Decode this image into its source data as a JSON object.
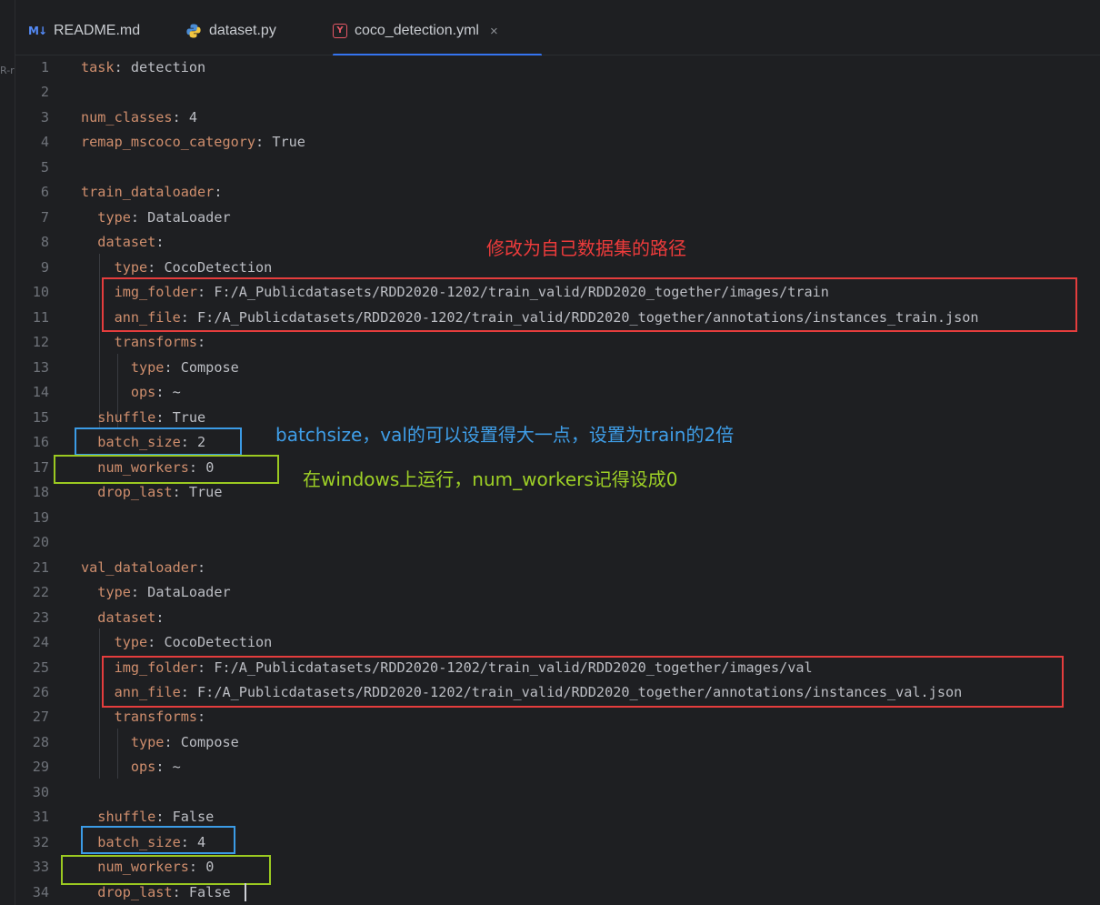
{
  "left_fragment": "R-r",
  "tabs": [
    {
      "icon": "markdown-icon",
      "icon_text": "M↓",
      "label": "README.md"
    },
    {
      "icon": "python-icon",
      "label": "dataset.py"
    },
    {
      "icon": "yaml-icon",
      "icon_text": "Y",
      "label": "coco_detection.yml",
      "active": true,
      "close": "×"
    }
  ],
  "lines": [
    {
      "n": "1",
      "key": "task",
      "val": " detection"
    },
    {
      "n": "2"
    },
    {
      "n": "3",
      "key": "num_classes",
      "val": " 4"
    },
    {
      "n": "4",
      "key": "remap_mscoco_category",
      "val": " True"
    },
    {
      "n": "5"
    },
    {
      "n": "6",
      "key": "train_dataloader",
      "val": ""
    },
    {
      "n": "7",
      "indent": "  ",
      "key": "type",
      "val": " DataLoader"
    },
    {
      "n": "8",
      "indent": "  ",
      "key": "dataset",
      "val": ""
    },
    {
      "n": "9",
      "indent": "    ",
      "key": "type",
      "val": " CocoDetection"
    },
    {
      "n": "10",
      "indent": "    ",
      "key": "img_folder",
      "val": " F:/A_Publicdatasets/RDD2020-1202/train_valid/RDD2020_together/images/train"
    },
    {
      "n": "11",
      "indent": "    ",
      "key": "ann_file",
      "val": " F:/A_Publicdatasets/RDD2020-1202/train_valid/RDD2020_together/annotations/instances_train.json"
    },
    {
      "n": "12",
      "indent": "    ",
      "key": "transforms",
      "val": ""
    },
    {
      "n": "13",
      "indent": "      ",
      "key": "type",
      "val": " Compose"
    },
    {
      "n": "14",
      "indent": "      ",
      "key": "ops",
      "val": " ~"
    },
    {
      "n": "15",
      "indent": "  ",
      "key": "shuffle",
      "val": " True"
    },
    {
      "n": "16",
      "indent": "  ",
      "key": "batch_size",
      "val": " 2"
    },
    {
      "n": "17",
      "indent": "  ",
      "key": "num_workers",
      "val": " 0"
    },
    {
      "n": "18",
      "indent": "  ",
      "key": "drop_last",
      "val": " True"
    },
    {
      "n": "19"
    },
    {
      "n": "20"
    },
    {
      "n": "21",
      "key": "val_dataloader",
      "val": ""
    },
    {
      "n": "22",
      "indent": "  ",
      "key": "type",
      "val": " DataLoader"
    },
    {
      "n": "23",
      "indent": "  ",
      "key": "dataset",
      "val": ""
    },
    {
      "n": "24",
      "indent": "    ",
      "key": "type",
      "val": " CocoDetection"
    },
    {
      "n": "25",
      "indent": "    ",
      "key": "img_folder",
      "val": " F:/A_Publicdatasets/RDD2020-1202/train_valid/RDD2020_together/images/val"
    },
    {
      "n": "26",
      "indent": "    ",
      "key": "ann_file",
      "val": " F:/A_Publicdatasets/RDD2020-1202/train_valid/RDD2020_together/annotations/instances_val.json"
    },
    {
      "n": "27",
      "indent": "    ",
      "key": "transforms",
      "val": ""
    },
    {
      "n": "28",
      "indent": "      ",
      "key": "type",
      "val": " Compose"
    },
    {
      "n": "29",
      "indent": "      ",
      "key": "ops",
      "val": " ~"
    },
    {
      "n": "30"
    },
    {
      "n": "31",
      "indent": "  ",
      "key": "shuffle",
      "val": " False"
    },
    {
      "n": "32",
      "indent": "  ",
      "key": "batch_size",
      "val": " 4"
    },
    {
      "n": "33",
      "indent": "  ",
      "key": "num_workers",
      "val": " 0"
    },
    {
      "n": "34",
      "indent": "  ",
      "key": "drop_last",
      "val": " False"
    }
  ],
  "annotations": {
    "path_note": "修改为自己数据集的路径",
    "batch_note": "batchsize，val的可以设置得大一点，设置为train的2倍",
    "workers_note": "在windows上运行，num_workers记得设成0"
  },
  "colors": {
    "background": "#1e1f22",
    "key": "#cf8e6d",
    "text": "#bcbec4",
    "line_number": "#6f737a",
    "accent": "#3574f0",
    "annotation_red": "#e53d3d",
    "annotation_blue": "#3b9be6",
    "annotation_green": "#9bc921"
  }
}
